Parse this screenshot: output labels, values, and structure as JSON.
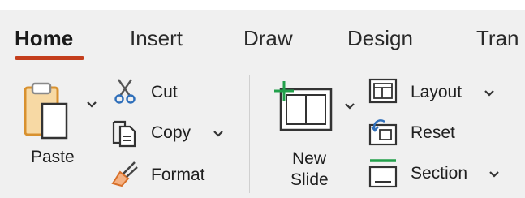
{
  "tabs": [
    {
      "label": "Home",
      "active": true
    },
    {
      "label": "Insert",
      "active": false
    },
    {
      "label": "Draw",
      "active": false
    },
    {
      "label": "Design",
      "active": false
    },
    {
      "label": "Tran",
      "active": false
    }
  ],
  "accent_color": "#c43e1c",
  "clipboard": {
    "paste_label": "Paste",
    "cut_label": "Cut",
    "copy_label": "Copy",
    "format_label": "Format"
  },
  "slides": {
    "new_slide_label_line1": "New",
    "new_slide_label_line2": "Slide",
    "layout_label": "Layout",
    "reset_label": "Reset",
    "section_label": "Section"
  },
  "icons": {
    "paste": "clipboard-paste-icon",
    "cut": "scissors-icon",
    "copy": "copy-icon",
    "format": "format-painter-icon",
    "new_slide": "new-slide-icon",
    "layout": "layout-icon",
    "reset": "reset-icon",
    "section": "section-icon"
  }
}
